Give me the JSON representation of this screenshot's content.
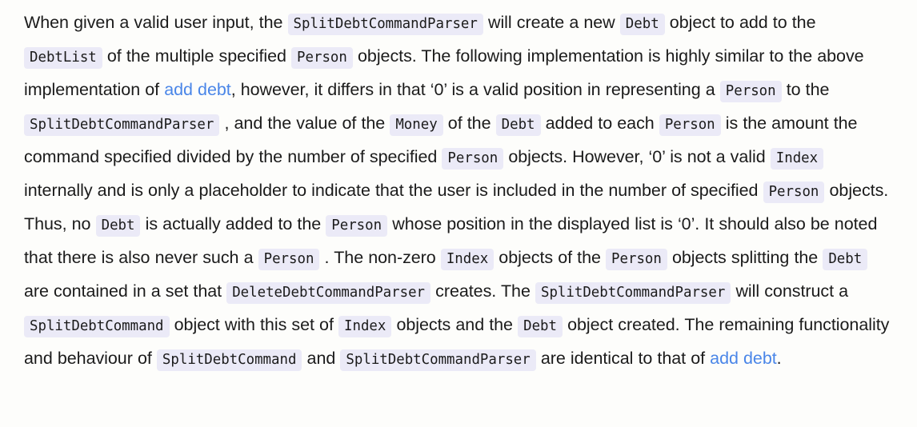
{
  "document": {
    "background_color": "#fdfdfb",
    "text_color": "#1b1b1b",
    "link_color": "#4a86e8",
    "code_chip_background": "#ebeaf7",
    "paragraph": {
      "segments": [
        {
          "type": "text",
          "value": "When given a valid user input, the "
        },
        {
          "type": "code",
          "value": "SplitDebtCommandParser"
        },
        {
          "type": "text",
          "value": " will create a new "
        },
        {
          "type": "code",
          "value": "Debt"
        },
        {
          "type": "text",
          "value": " object to add to the "
        },
        {
          "type": "code",
          "value": "DebtList"
        },
        {
          "type": "text",
          "value": " of the multiple specified "
        },
        {
          "type": "code",
          "value": "Person"
        },
        {
          "type": "text",
          "value": " objects. The following implementation is highly similar to the above implementation of "
        },
        {
          "type": "link",
          "value": "add debt"
        },
        {
          "type": "text",
          "value": ", however, it differs in that ‘0’ is a valid position in representing a "
        },
        {
          "type": "code",
          "value": "Person"
        },
        {
          "type": "text",
          "value": " to the "
        },
        {
          "type": "code",
          "value": "SplitDebtCommandParser"
        },
        {
          "type": "text",
          "value": " , and the value of the "
        },
        {
          "type": "code",
          "value": "Money"
        },
        {
          "type": "text",
          "value": " of the "
        },
        {
          "type": "code",
          "value": "Debt"
        },
        {
          "type": "text",
          "value": " added to each "
        },
        {
          "type": "code",
          "value": "Person"
        },
        {
          "type": "text",
          "value": " is the amount the command specified divided by the number of specified "
        },
        {
          "type": "code",
          "value": "Person"
        },
        {
          "type": "text",
          "value": " objects. However, ‘0’ is not a valid "
        },
        {
          "type": "code",
          "value": "Index"
        },
        {
          "type": "text",
          "value": " internally and is only a placeholder to indicate that the user is included in the number of specified "
        },
        {
          "type": "code",
          "value": "Person"
        },
        {
          "type": "text",
          "value": " objects. Thus, no "
        },
        {
          "type": "code",
          "value": "Debt"
        },
        {
          "type": "text",
          "value": " is actually added to the "
        },
        {
          "type": "code",
          "value": "Person"
        },
        {
          "type": "text",
          "value": " whose position in the displayed list is ‘0’. It should also be noted that there is also never such a "
        },
        {
          "type": "code",
          "value": "Person"
        },
        {
          "type": "text",
          "value": " . The non-zero "
        },
        {
          "type": "code",
          "value": "Index"
        },
        {
          "type": "text",
          "value": " objects of the "
        },
        {
          "type": "code",
          "value": "Person"
        },
        {
          "type": "text",
          "value": " objects splitting the "
        },
        {
          "type": "code",
          "value": "Debt"
        },
        {
          "type": "text",
          "value": " are contained in a set that "
        },
        {
          "type": "code",
          "value": "DeleteDebtCommandParser"
        },
        {
          "type": "text",
          "value": " creates. The "
        },
        {
          "type": "code",
          "value": "SplitDebtCommandParser"
        },
        {
          "type": "text",
          "value": " will construct a "
        },
        {
          "type": "code",
          "value": "SplitDebtCommand"
        },
        {
          "type": "text",
          "value": " object with this set of "
        },
        {
          "type": "code",
          "value": "Index"
        },
        {
          "type": "text",
          "value": " objects and the "
        },
        {
          "type": "code",
          "value": "Debt"
        },
        {
          "type": "text",
          "value": " object created. The remaining functionality and behaviour of "
        },
        {
          "type": "code",
          "value": "SplitDebtCommand"
        },
        {
          "type": "text",
          "value": " and "
        },
        {
          "type": "code",
          "value": "SplitDebtCommandParser"
        },
        {
          "type": "text",
          "value": " are identical to that of "
        },
        {
          "type": "link",
          "value": "add debt"
        },
        {
          "type": "text",
          "value": "."
        }
      ]
    }
  }
}
